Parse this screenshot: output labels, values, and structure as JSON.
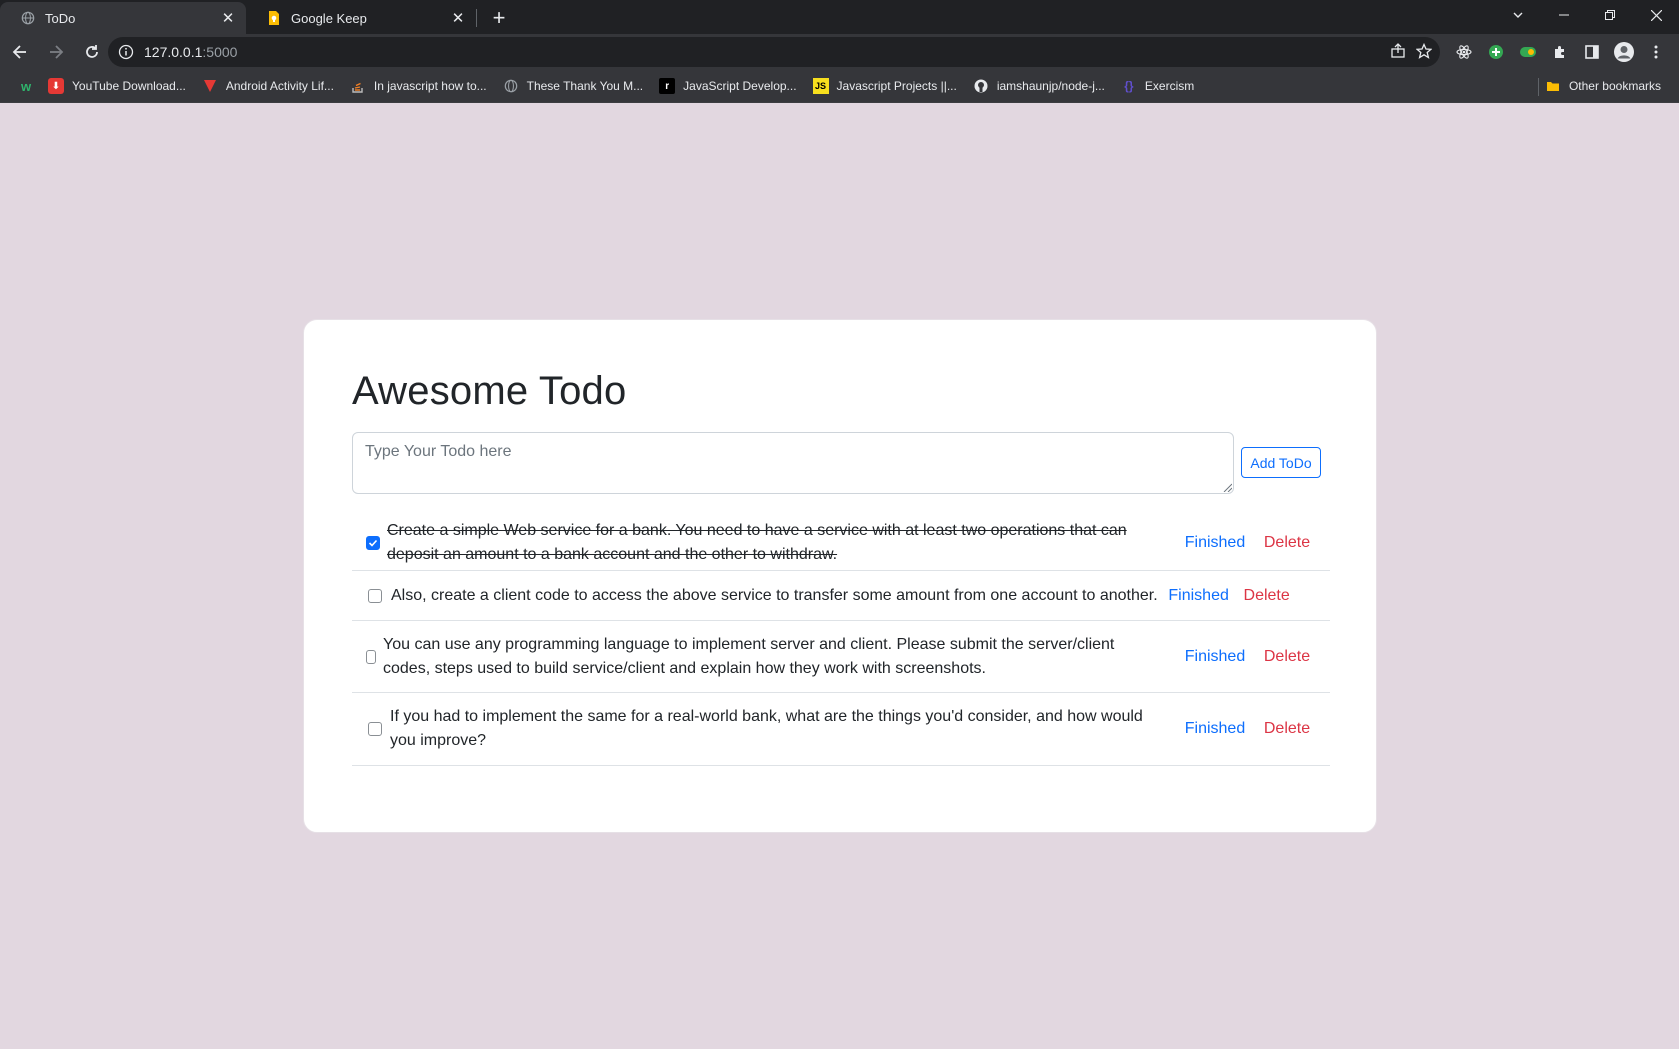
{
  "browser": {
    "tabs": [
      {
        "title": "ToDo",
        "icon": "globe-icon",
        "active": true
      },
      {
        "title": "Google Keep",
        "icon": "google-keep-icon",
        "active": false
      }
    ],
    "address": {
      "host": "127.0.0.1",
      "port": ":5000"
    },
    "bookmarks": [
      {
        "label": "",
        "icon": "w-icon"
      },
      {
        "label": "YouTube Download...",
        "icon": "download-icon"
      },
      {
        "label": "Android Activity Lif...",
        "icon": "vivaldi-icon"
      },
      {
        "label": "In javascript how to...",
        "icon": "stackoverflow-icon"
      },
      {
        "label": "These Thank You M...",
        "icon": "globe-icon"
      },
      {
        "label": "JavaScript Develop...",
        "icon": "r-icon"
      },
      {
        "label": "Javascript Projects ||...",
        "icon": "js-icon"
      },
      {
        "label": "iamshaunjp/node-j...",
        "icon": "github-icon"
      },
      {
        "label": "Exercism",
        "icon": "exercism-icon"
      }
    ],
    "other_bookmarks": "Other bookmarks"
  },
  "app": {
    "title": "Awesome Todo",
    "input_placeholder": "Type Your Todo here",
    "add_button": "Add ToDo",
    "finished_label": "Finished",
    "delete_label": "Delete",
    "todos": [
      {
        "text": "Create a simple Web service for a bank. You need to have a service with at least two operations that can deposit an amount to a bank account and the other to withdraw.",
        "done": true
      },
      {
        "text": "Also, create a client code to access the above service to transfer some amount from one account to another.",
        "done": false
      },
      {
        "text": "You can use any programming language to implement server and client. Please submit the server/client codes, steps used to build service/client and explain how they work with screenshots.",
        "done": false
      },
      {
        "text": "If you had to implement the same for a real-world bank, what are the things you'd consider, and how would you improve?",
        "done": false
      }
    ]
  },
  "colors": {
    "page_bg": "#e2d7e0",
    "primary": "#0d6efd",
    "danger": "#dc3545"
  }
}
